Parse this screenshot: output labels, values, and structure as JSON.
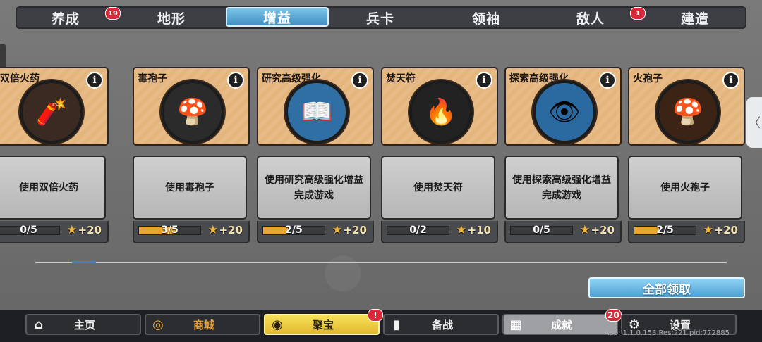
{
  "tabs": [
    {
      "label": "养成",
      "badge": "19",
      "active": false
    },
    {
      "label": "地形",
      "badge": "",
      "active": false
    },
    {
      "label": "增益",
      "badge": "",
      "active": true
    },
    {
      "label": "兵卡",
      "badge": "",
      "active": false
    },
    {
      "label": "领袖",
      "badge": "",
      "active": false
    },
    {
      "label": "敌人",
      "badge": "1",
      "active": false
    },
    {
      "label": "建造",
      "badge": "",
      "active": false
    }
  ],
  "cards": [
    {
      "title": "双倍火药",
      "description": "使用双倍火药",
      "progress": "0/5",
      "progress_fraction": 0,
      "reward": "+20",
      "icon": "double-gunpowder-icon",
      "icon_glyph": "🧨",
      "icon_bg": "#3a2a22"
    },
    {
      "title": "毒孢子",
      "description": "使用毒孢子",
      "progress": "3/5",
      "progress_fraction": 0.6,
      "reward": "+20",
      "icon": "poison-spore-icon",
      "icon_glyph": "🍄",
      "icon_bg": "#2b2b2b"
    },
    {
      "title": "研究高级强化",
      "description": "使用研究高级强化增益完成游戏",
      "progress": "2/5",
      "progress_fraction": 0.4,
      "reward": "+20",
      "icon": "research-book-icon",
      "icon_glyph": "📖",
      "icon_bg": "#2f6fa3"
    },
    {
      "title": "焚天符",
      "description": "使用焚天符",
      "progress": "0/2",
      "progress_fraction": 0,
      "reward": "+10",
      "icon": "fire-talisman-icon",
      "icon_glyph": "🔥",
      "icon_bg": "#222222"
    },
    {
      "title": "探索高级强化",
      "description": "使用探索高级强化增益完成游戏",
      "progress": "0/5",
      "progress_fraction": 0,
      "reward": "+20",
      "icon": "explore-eye-icon",
      "icon_glyph": "👁",
      "icon_bg": "#2b6aa0"
    },
    {
      "title": "火孢子",
      "description": "使用火孢子",
      "progress": "2/5",
      "progress_fraction": 0.4,
      "reward": "+20",
      "icon": "fire-spore-icon",
      "icon_glyph": "🍄",
      "icon_bg": "#3b2416"
    }
  ],
  "claim_all_label": "全部领取",
  "nav": [
    {
      "label": "主页",
      "icon": "home-icon",
      "glyph": "⌂",
      "badge": ""
    },
    {
      "label": "商城",
      "icon": "coins-icon",
      "glyph": "◎",
      "badge": ""
    },
    {
      "label": "聚宝",
      "icon": "treasure-bowl-icon",
      "glyph": "◉",
      "badge": "!"
    },
    {
      "label": "备战",
      "icon": "cards-icon",
      "glyph": "▮",
      "badge": ""
    },
    {
      "label": "成就",
      "icon": "achievement-icon",
      "glyph": "▦",
      "badge": "20"
    },
    {
      "label": "设置",
      "icon": "gear-icon",
      "glyph": "⚙",
      "badge": ""
    }
  ],
  "footer": "App: 1.1.0.158 Res:221 pid:772885",
  "colors": {
    "accent": "#4d9fd1",
    "badge": "#d8283a",
    "progress": "#e9a531",
    "card_top": "#e4b57d"
  }
}
